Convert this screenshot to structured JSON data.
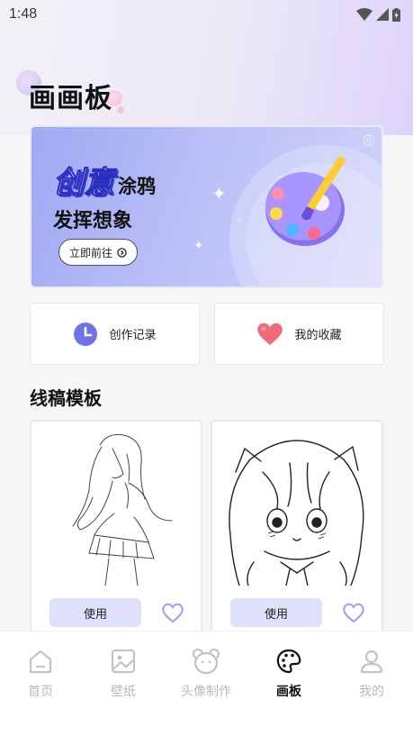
{
  "status_bar": {
    "time": "1:48"
  },
  "page": {
    "title": "画画板"
  },
  "banner": {
    "title_big": "创意",
    "title_small": "涂鸦",
    "subtitle": "发挥想象",
    "button_label": "立即前往"
  },
  "quick_actions": [
    {
      "label": "创作记录",
      "icon": "clock-icon"
    },
    {
      "label": "我的收藏",
      "icon": "heart-icon"
    }
  ],
  "section": {
    "title": "线稿模板"
  },
  "templates": [
    {
      "use_label": "使用",
      "favorited": false
    },
    {
      "use_label": "使用",
      "favorited": false
    }
  ],
  "bottom_nav": {
    "active_index": 3,
    "items": [
      {
        "label": "首页",
        "icon": "home-icon"
      },
      {
        "label": "壁纸",
        "icon": "image-icon"
      },
      {
        "label": "头像制作",
        "icon": "bear-icon"
      },
      {
        "label": "画板",
        "icon": "palette-icon"
      },
      {
        "label": "我的",
        "icon": "user-icon"
      }
    ]
  },
  "colors": {
    "accent": "#6f73e6",
    "use_button_bg": "#dfe1fb",
    "heart": "#ef6b79",
    "banner_start": "#9fa9f3",
    "banner_end": "#d3d4fa"
  }
}
